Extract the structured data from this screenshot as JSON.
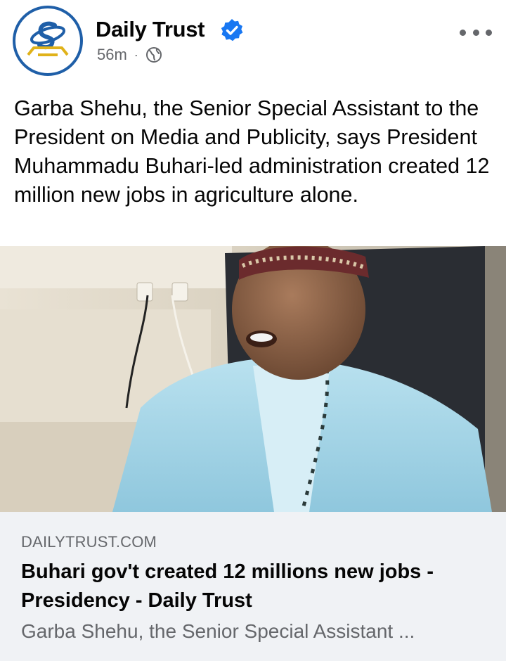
{
  "post": {
    "page_name": "Daily Trust",
    "verified": true,
    "timestamp": "56m",
    "separator": "·",
    "audience_icon": "globe-icon",
    "more_icon": "more-options-icon",
    "caption": "Garba Shehu, the Senior Special Assistant to the President on Media and Publicity, says President Muhammadu Buhari-led administration created 12 million new jobs in agriculture alone.",
    "image_icon": "photo-of-speaker"
  },
  "link": {
    "domain": "DAILYTRUST.COM",
    "title": "Buhari gov't created 12 millions new jobs - Presidency - Daily Trust",
    "description": "Garba Shehu, the Senior Special Assistant ..."
  },
  "colors": {
    "verified_blue": "#1877f2",
    "logo_blue": "#1f5fa8",
    "logo_gold": "#e0b21a",
    "link_bg": "#f0f2f5",
    "secondary_text": "#65676b"
  }
}
